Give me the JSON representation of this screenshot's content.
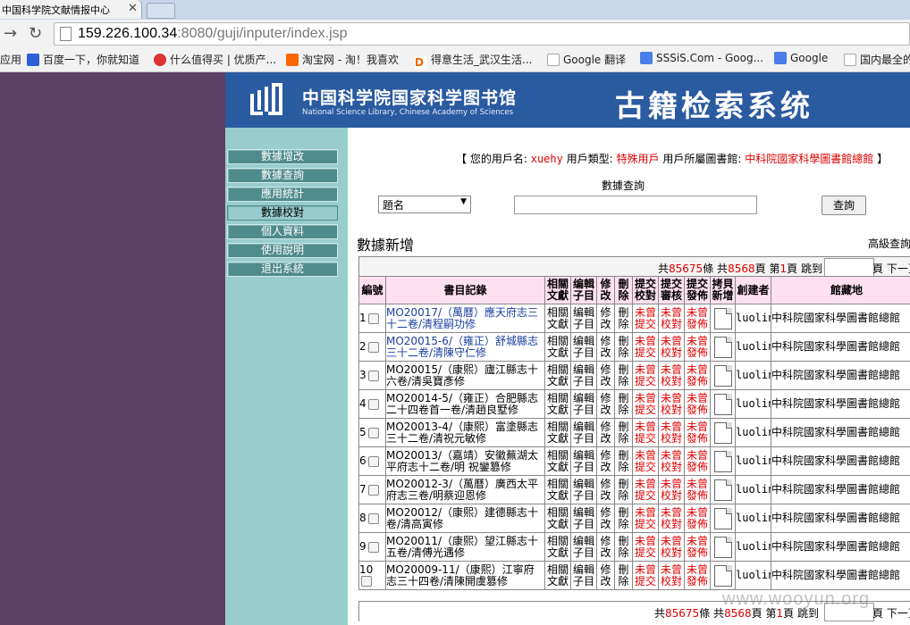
{
  "browser": {
    "tab_title": "中国科学院文献情报中心",
    "url_host": "159.226.100.34",
    "url_rest": ":8080/guji/inputer/index.jsp",
    "bookmarks": [
      "应用",
      "百度一下，你就知道",
      "什么值得买 | 优质产...",
      "淘宝网 - 淘！我喜欢",
      "得意生活_武汉生活...",
      "Google 翻译",
      "SSSiS.Com - Goog...",
      "Google",
      "国内最全的"
    ]
  },
  "banner": {
    "logo_cn": "中国科学院国家科学图书馆",
    "logo_en": "National Science Library, Chinese Academy of Sciences",
    "system_title": "古籍检索系统"
  },
  "sidebar": {
    "items": [
      "數據增改",
      "數據查詢",
      "應用統計",
      "數據校對",
      "個人資料",
      "使用說明",
      "退出系統"
    ]
  },
  "userinfo": {
    "open": "【",
    "username_label": "您的用戶名:",
    "username": "xuehy",
    "type_label": "用戶類型:",
    "type": "特殊用戶",
    "library_label": "用戶所屬圖書館:",
    "library": "中科院國家科學圖書館總館",
    "close": "】"
  },
  "query": {
    "label": "數據查詢",
    "field": "題名",
    "button": "查詢"
  },
  "section": {
    "title": "數據新增",
    "advanced": "高級查詢"
  },
  "pager": {
    "total_label": "共",
    "total_records": "85675",
    "records_unit": "條",
    "total_pages": "8568",
    "pages_unit": "頁",
    "page_label": "第",
    "current_page": "1",
    "jump_label": "跳到",
    "jump_unit": "頁",
    "next": "下一頁"
  },
  "table": {
    "headers": [
      "編號",
      "書目記錄",
      "相關文獻",
      "编輯子目",
      "修改",
      "刪除",
      "提交校對",
      "提交審核",
      "提交發佈",
      "拷貝新增",
      "創建者",
      "館藏地"
    ],
    "rows": [
      {
        "no": "1",
        "record": "MO20017/（萬曆）應天府志三十二卷/清程嗣功修",
        "link": true
      },
      {
        "no": "2",
        "record": "MO20015-6/（雍正）舒城縣志三十二卷/清陳守仁修",
        "link": true
      },
      {
        "no": "3",
        "record": "MO20015/（康熙）廬江縣志十六卷/清吳寶彥修",
        "link": false
      },
      {
        "no": "4",
        "record": "MO20014-5/（雍正）合肥縣志二十四卷首一卷/清趙良墅修",
        "link": false
      },
      {
        "no": "5",
        "record": "MO20013-4/（康熙）富塗縣志三十二卷/清祝元敏修",
        "link": false
      },
      {
        "no": "6",
        "record": "MO20013/（嘉靖）安徽蕪湖太平府志十二卷/明 祝鑾篡修",
        "link": false
      },
      {
        "no": "7",
        "record": "MO20012-3/（萬曆）廣西太平府志三卷/明蔡迎恩修",
        "link": false
      },
      {
        "no": "8",
        "record": "MO20012/（康熙）建德縣志十卷/清高寅修",
        "link": false
      },
      {
        "no": "9",
        "record": "MO20011/（康熙）望江縣志十五卷/清傅光遇修",
        "link": false
      },
      {
        "no": "10",
        "record": "MO20009-11/（康熙）江寧府志三十四卷/清陳開虞篡修",
        "link": false
      }
    ],
    "related": "相關文獻",
    "edit_sub": "编輯子目",
    "modify": "修改",
    "delete": "刪除",
    "status": "未曾提交",
    "status_review": "未曾校對",
    "status_publish": "未曾發佈",
    "creator": "luolin",
    "holder": "中科院國家科學圖書館總館"
  },
  "watermark": "www.wooyun.org"
}
